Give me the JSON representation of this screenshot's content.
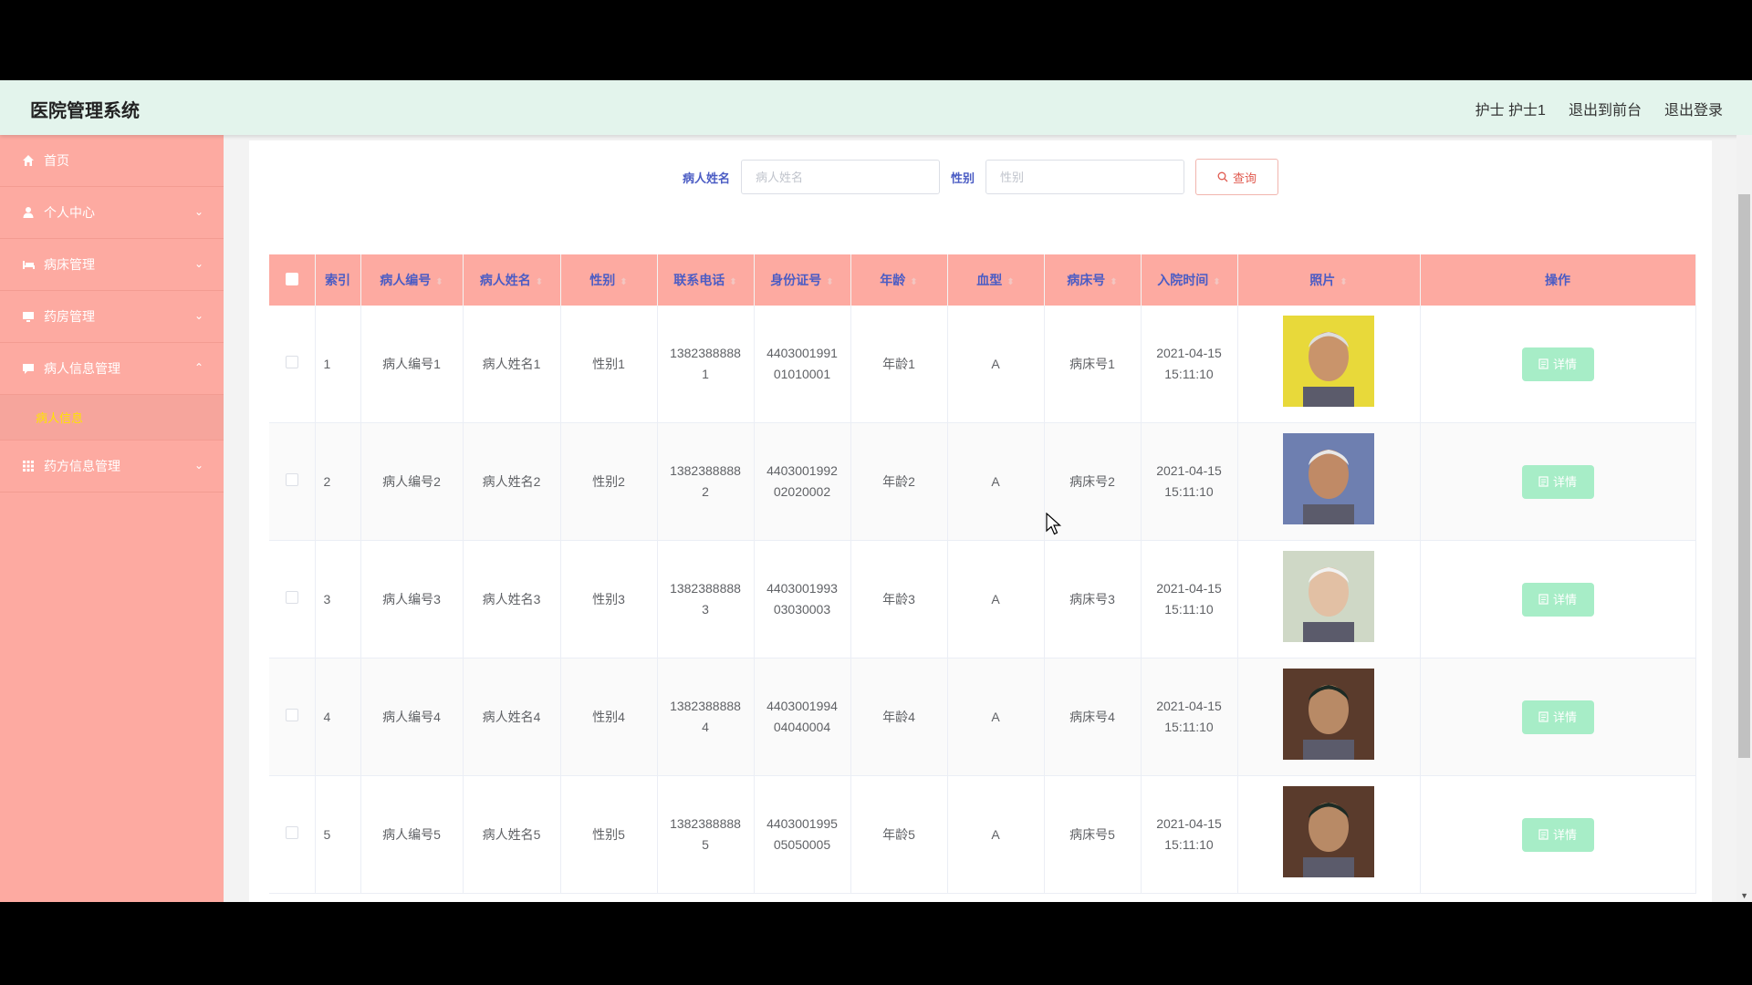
{
  "app": {
    "title": "医院管理系统"
  },
  "top_links": [
    "护士 护士1",
    "退出到前台",
    "退出登录"
  ],
  "sidebar": {
    "items": [
      {
        "label": "首页",
        "icon": "home-icon",
        "chevron": ""
      },
      {
        "label": "个人中心",
        "icon": "user-icon",
        "chevron": "⌄"
      },
      {
        "label": "病床管理",
        "icon": "bed-icon",
        "chevron": "⌄"
      },
      {
        "label": "药房管理",
        "icon": "monitor-icon",
        "chevron": "⌄"
      },
      {
        "label": "病人信息管理",
        "icon": "chat-icon",
        "chevron": "⌃"
      },
      {
        "label": "药方信息管理",
        "icon": "grid-icon",
        "chevron": "⌄"
      }
    ],
    "submenu_label": "病人信息"
  },
  "search": {
    "name_label": "病人姓名",
    "name_placeholder": "病人姓名",
    "gender_label": "性别",
    "gender_placeholder": "性别",
    "query_label": "查询"
  },
  "table": {
    "headers": [
      "索引",
      "病人编号",
      "病人姓名",
      "性别",
      "联系电话",
      "身份证号",
      "年龄",
      "血型",
      "病床号",
      "入院时间",
      "照片",
      "操作"
    ],
    "detail_label": "详情",
    "rows": [
      {
        "index": "1",
        "id": "病人编号1",
        "name": "病人姓名1",
        "gender": "性别1",
        "phone_a": "1382388888",
        "phone_b": "1",
        "idcard_a": "4403001991",
        "idcard_b": "01010001",
        "age": "年龄1",
        "blood": "A",
        "bed": "病床号1",
        "date_a": "2021-04-15",
        "date_b": "15:11:10"
      },
      {
        "index": "2",
        "id": "病人编号2",
        "name": "病人姓名2",
        "gender": "性别2",
        "phone_a": "1382388888",
        "phone_b": "2",
        "idcard_a": "4403001992",
        "idcard_b": "02020002",
        "age": "年龄2",
        "blood": "A",
        "bed": "病床号2",
        "date_a": "2021-04-15",
        "date_b": "15:11:10"
      },
      {
        "index": "3",
        "id": "病人编号3",
        "name": "病人姓名3",
        "gender": "性别3",
        "phone_a": "1382388888",
        "phone_b": "3",
        "idcard_a": "4403001993",
        "idcard_b": "03030003",
        "age": "年龄3",
        "blood": "A",
        "bed": "病床号3",
        "date_a": "2021-04-15",
        "date_b": "15:11:10"
      },
      {
        "index": "4",
        "id": "病人编号4",
        "name": "病人姓名4",
        "gender": "性别4",
        "phone_a": "1382388888",
        "phone_b": "4",
        "idcard_a": "4403001994",
        "idcard_b": "04040004",
        "age": "年龄4",
        "blood": "A",
        "bed": "病床号4",
        "date_a": "2021-04-15",
        "date_b": "15:11:10"
      },
      {
        "index": "5",
        "id": "病人编号5",
        "name": "病人姓名5",
        "gender": "性别5",
        "phone_a": "1382388888",
        "phone_b": "5",
        "idcard_a": "4403001995",
        "idcard_b": "05050005",
        "age": "年龄5",
        "blood": "A",
        "bed": "病床号5",
        "date_a": "2021-04-15",
        "date_b": "15:11:10"
      }
    ]
  },
  "colors": {
    "topbar": "#e3f4ec",
    "sidebar": "#fdaaa1",
    "header_text": "#4b5cc4",
    "detail_button": "#a7edc7",
    "active_submenu": "#ffe400"
  }
}
